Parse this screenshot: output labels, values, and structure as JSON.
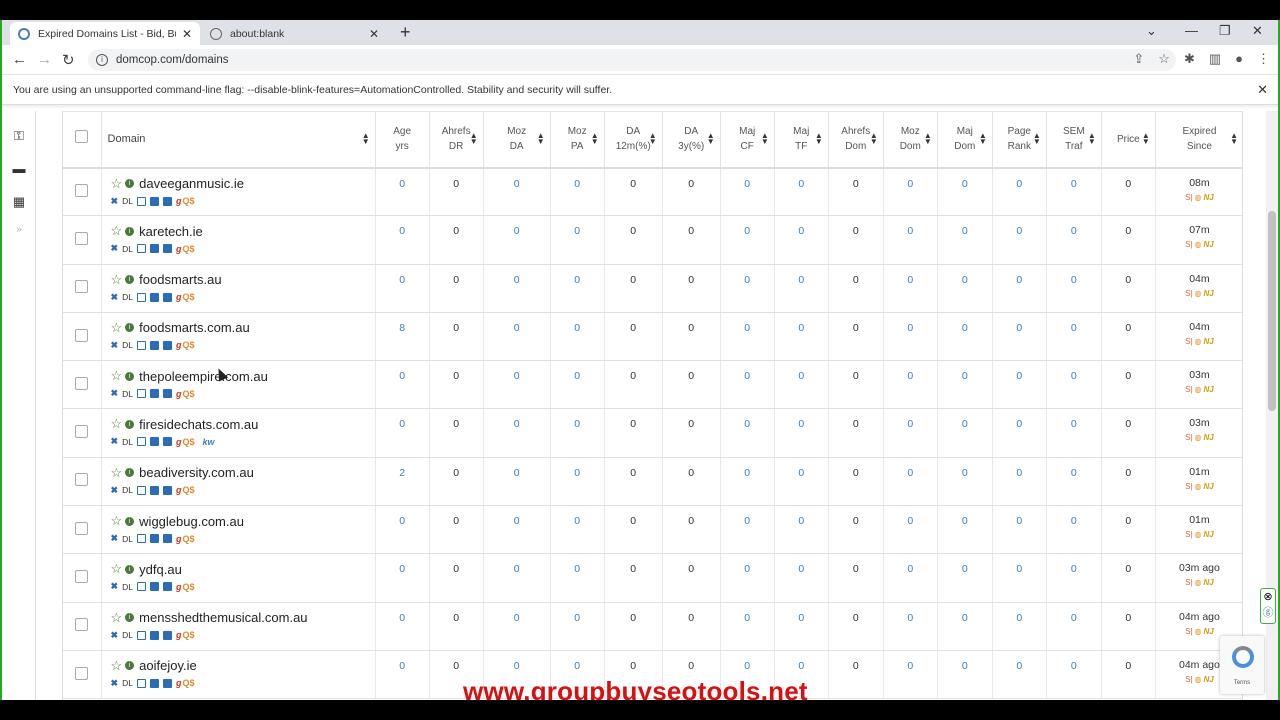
{
  "browser": {
    "tabs": [
      {
        "title": "Expired Domains List - Bid, Buy c",
        "active": true
      },
      {
        "title": "about:blank",
        "active": false
      }
    ],
    "url": "domcop.com/domains",
    "warning": "You are using an unsupported command-line flag: --disable-blink-features=AutomationControlled. Stability and security will suffer."
  },
  "table": {
    "headers": [
      {
        "line1": "Domain",
        "line2": ""
      },
      {
        "line1": "Age",
        "line2": "yrs"
      },
      {
        "line1": "Ahrefs",
        "line2": "DR"
      },
      {
        "line1": "Moz",
        "line2": "DA"
      },
      {
        "line1": "Moz",
        "line2": "PA"
      },
      {
        "line1": "DA",
        "line2": "12m(%)"
      },
      {
        "line1": "DA",
        "line2": "3y(%)"
      },
      {
        "line1": "Maj",
        "line2": "CF"
      },
      {
        "line1": "Maj",
        "line2": "TF"
      },
      {
        "line1": "Ahrefs",
        "line2": "Dom"
      },
      {
        "line1": "Moz",
        "line2": "Dom"
      },
      {
        "line1": "Maj",
        "line2": "Dom"
      },
      {
        "line1": "Page",
        "line2": "Rank"
      },
      {
        "line1": "SEM",
        "line2": "Traf"
      },
      {
        "line1": "Price",
        "line2": ""
      },
      {
        "line1": "Expired",
        "line2": "Since"
      }
    ],
    "tool_labels": {
      "x": "✖",
      "dl": "DL",
      "g": "g",
      "q": "Q$",
      "kw": "kw"
    },
    "source_labels": {
      "s1": "S|",
      "s2": "◍",
      "s3": "NJ"
    },
    "rows": [
      {
        "domain": "daveeganmusic.ie",
        "age": "0",
        "dr": "0",
        "da": "0",
        "pa": "0",
        "da12": "0",
        "da3y": "0",
        "cf": "0",
        "tf": "0",
        "adom": "0",
        "mdom": "0",
        "majdom": "0",
        "pr": "0",
        "sem": "0",
        "price": "0",
        "expired": "08m",
        "kw": ""
      },
      {
        "domain": "karetech.ie",
        "age": "0",
        "dr": "0",
        "da": "0",
        "pa": "0",
        "da12": "0",
        "da3y": "0",
        "cf": "0",
        "tf": "0",
        "adom": "0",
        "mdom": "0",
        "majdom": "0",
        "pr": "0",
        "sem": "0",
        "price": "0",
        "expired": "07m",
        "kw": ""
      },
      {
        "domain": "foodsmarts.au",
        "age": "0",
        "dr": "0",
        "da": "0",
        "pa": "0",
        "da12": "0",
        "da3y": "0",
        "cf": "0",
        "tf": "0",
        "adom": "0",
        "mdom": "0",
        "majdom": "0",
        "pr": "0",
        "sem": "0",
        "price": "0",
        "expired": "04m",
        "kw": ""
      },
      {
        "domain": "foodsmarts.com.au",
        "age": "8",
        "dr": "0",
        "da": "0",
        "pa": "0",
        "da12": "0",
        "da3y": "0",
        "cf": "0",
        "tf": "0",
        "adom": "0",
        "mdom": "0",
        "majdom": "0",
        "pr": "0",
        "sem": "0",
        "price": "0",
        "expired": "04m",
        "kw": ""
      },
      {
        "domain": "thepoleempire.com.au",
        "age": "0",
        "dr": "0",
        "da": "0",
        "pa": "0",
        "da12": "0",
        "da3y": "0",
        "cf": "0",
        "tf": "0",
        "adom": "0",
        "mdom": "0",
        "majdom": "0",
        "pr": "0",
        "sem": "0",
        "price": "0",
        "expired": "03m",
        "kw": ""
      },
      {
        "domain": "firesidechats.com.au",
        "age": "0",
        "dr": "0",
        "da": "0",
        "pa": "0",
        "da12": "0",
        "da3y": "0",
        "cf": "0",
        "tf": "0",
        "adom": "0",
        "mdom": "0",
        "majdom": "0",
        "pr": "0",
        "sem": "0",
        "price": "0",
        "expired": "03m",
        "kw": "kw"
      },
      {
        "domain": "beadiversity.com.au",
        "age": "2",
        "dr": "0",
        "da": "0",
        "pa": "0",
        "da12": "0",
        "da3y": "0",
        "cf": "0",
        "tf": "0",
        "adom": "0",
        "mdom": "0",
        "majdom": "0",
        "pr": "0",
        "sem": "0",
        "price": "0",
        "expired": "01m",
        "kw": ""
      },
      {
        "domain": "wigglebug.com.au",
        "age": "0",
        "dr": "0",
        "da": "0",
        "pa": "0",
        "da12": "0",
        "da3y": "0",
        "cf": "0",
        "tf": "0",
        "adom": "0",
        "mdom": "0",
        "majdom": "0",
        "pr": "0",
        "sem": "0",
        "price": "0",
        "expired": "01m",
        "kw": ""
      },
      {
        "domain": "ydfq.au",
        "age": "0",
        "dr": "0",
        "da": "0",
        "pa": "0",
        "da12": "0",
        "da3y": "0",
        "cf": "0",
        "tf": "0",
        "adom": "0",
        "mdom": "0",
        "majdom": "0",
        "pr": "0",
        "sem": "0",
        "price": "0",
        "expired": "03m ago",
        "kw": ""
      },
      {
        "domain": "mensshedthemusical.com.au",
        "age": "0",
        "dr": "0",
        "da": "0",
        "pa": "0",
        "da12": "0",
        "da3y": "0",
        "cf": "0",
        "tf": "0",
        "adom": "0",
        "mdom": "0",
        "majdom": "0",
        "pr": "0",
        "sem": "0",
        "price": "0",
        "expired": "04m ago",
        "kw": ""
      },
      {
        "domain": "aoifejoy.ie",
        "age": "0",
        "dr": "0",
        "da": "0",
        "pa": "0",
        "da12": "0",
        "da3y": "0",
        "cf": "0",
        "tf": "0",
        "adom": "0",
        "mdom": "0",
        "majdom": "0",
        "pr": "0",
        "sem": "0",
        "price": "0",
        "expired": "04m ago",
        "kw": ""
      }
    ]
  },
  "watermark": "www.groupbuyseotools.net",
  "recaptcha_label": "Terms"
}
